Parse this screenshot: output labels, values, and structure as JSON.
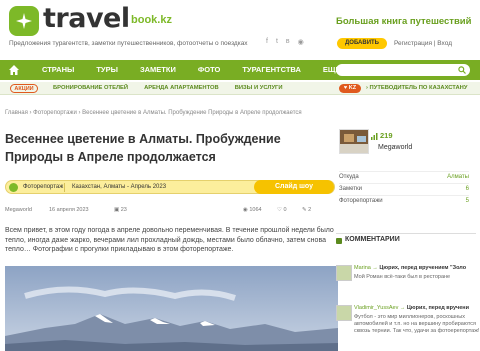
{
  "site": {
    "logo_text": "travel",
    "logo_suffix": "book.kz",
    "tagline": "Предложения турагентств, заметки путешественников, фотоотчеты о поездках",
    "slogan": "Большая книга путешествий",
    "add_label": "ДОБАВИТЬ",
    "auth_label": "Регистрация | Вход",
    "accent": "#79ad23"
  },
  "nav": {
    "items": [
      "СТРАНЫ",
      "ТУРЫ",
      "ЗАМЕТКИ",
      "ФОТО",
      "ТУРАГЕНТСТВА",
      "ЕЩЕ"
    ]
  },
  "subnav": {
    "promo": "АКЦИИ",
    "items": [
      "БРОНИРОВАНИЕ ОТЕЛЕЙ",
      "АРЕНДА АПАРТАМЕНТОВ",
      "ВИЗЫ И УСЛУГИ"
    ],
    "kz_badge": "KZ",
    "kz_link": "ПУТЕВОДИТЕЛЬ ПО КАЗАХСТАНУ"
  },
  "breadcrumb": "Главная › Фоторепортажи › Весеннее цветение в Алматы. Пробуждение Природы в Апреле продолжается",
  "article": {
    "title": "Весеннее цветение в Алматы. Пробуждение Природы в Апреле продолжается",
    "category": "Фоторепортаж",
    "location": "Казахстан, Алматы - Апрель 2023",
    "slideshow": "Слайд шоу",
    "author": "Megaworld",
    "date": "16 апреля 2023",
    "photos": "23",
    "views": "1064",
    "likes": "0",
    "comments": "2",
    "body": "Всем привет, в этом году погода в апреле довольно переменчивая. В течение прошлой недели было тепло, иногда даже жарко, вечерами лил прохладный дождь, местами было облачно, затем снова тепло… Фотографии с прогулки прикладываю в этом фоторепортаже."
  },
  "profile": {
    "rank": "219",
    "username": "Megaworld",
    "rows": [
      {
        "label": "Откуда",
        "value": "Алматы"
      },
      {
        "label": "Заметки",
        "value": "6"
      },
      {
        "label": "Фоторепортажи",
        "value": "5"
      }
    ]
  },
  "comments": {
    "heading": "КОММЕНТАРИИ",
    "items": [
      {
        "author": "Marina",
        "topic": "Цюрих, перед вручением \"Золо",
        "text": "Мой Роман всё-таки был в ресторане"
      },
      {
        "author": "Vladimir_YussAev",
        "topic": "Цюрих, перед вручени",
        "text": "Футбол - это мир миллионеров, роскошных автомобилей и т.п. но на вершину пробираются сквозь тернии. Так что, удачи за фотоерепортаж!"
      }
    ]
  }
}
